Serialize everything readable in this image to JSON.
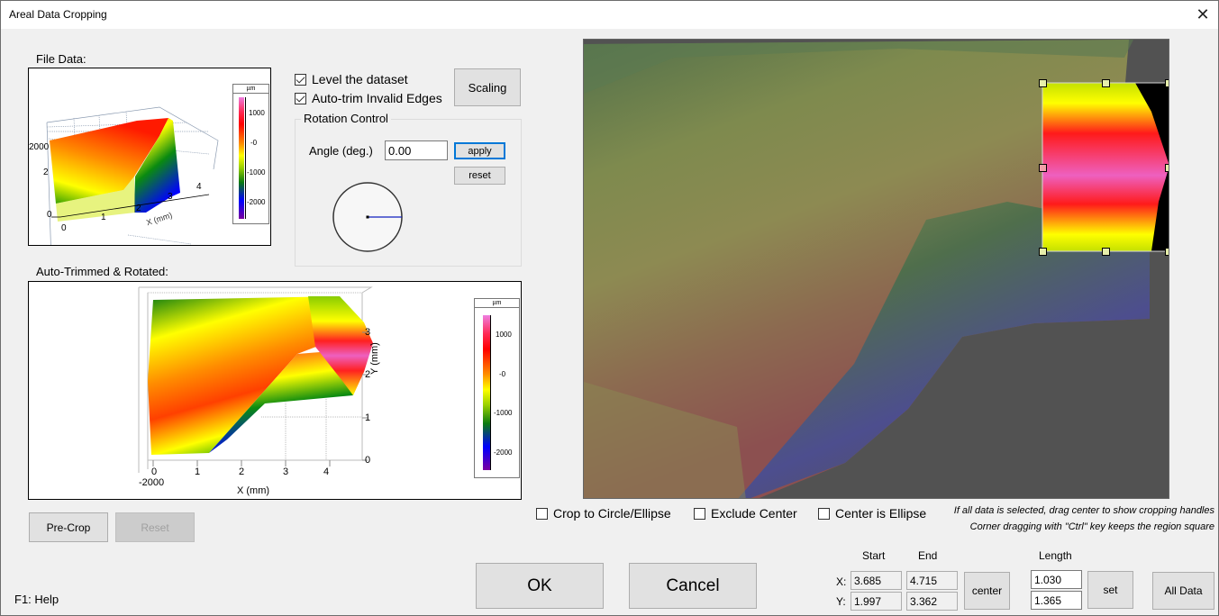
{
  "window": {
    "title": "Areal Data Cropping",
    "close_icon": "close-x"
  },
  "file_data": {
    "label": "File Data:",
    "x_axis_label": "X (mm)",
    "x_ticks": [
      "0",
      "1",
      "2",
      "3",
      "4"
    ],
    "y_ticks": [
      "0",
      "2"
    ],
    "z_tick": "2000",
    "colorbar": {
      "unit": "µm",
      "ticks": [
        "1000",
        "-0",
        "-1000",
        "-2000"
      ]
    }
  },
  "options": {
    "level_dataset": {
      "label": "Level the dataset",
      "checked": true
    },
    "auto_trim": {
      "label": "Auto-trim Invalid Edges",
      "checked": true
    },
    "scaling_button": "Scaling"
  },
  "rotation": {
    "group_label": "Rotation Control",
    "angle_label": "Angle (deg.)",
    "angle_value": "0.00",
    "apply_button": "apply",
    "reset_button": "reset",
    "dial_angle_deg": 0
  },
  "trimmed": {
    "label": "Auto-Trimmed & Rotated:",
    "x_axis_label": "X (mm)",
    "y_axis_label": "Y (mm)",
    "x_ticks": [
      "0",
      "1",
      "2",
      "3",
      "4"
    ],
    "y_ticks": [
      "0",
      "1",
      "2",
      "3"
    ],
    "z_tick": "-2000",
    "colorbar": {
      "unit": "µm",
      "ticks": [
        "1000",
        "-0",
        "-1000",
        "-2000"
      ]
    }
  },
  "precrop": {
    "precrop_button": "Pre-Crop",
    "reset_button": "Reset",
    "reset_disabled": true
  },
  "crop_options": {
    "circle": {
      "label": "Crop to Circle/Ellipse",
      "checked": false
    },
    "exclude_center": {
      "label": "Exclude Center",
      "checked": false
    },
    "center_ellipse": {
      "label": "Center is Ellipse",
      "checked": false
    }
  },
  "hints": {
    "line1": "If all data is selected, drag center to show cropping handles",
    "line2": "Corner dragging with \"Ctrl\" key keeps the region square"
  },
  "coords": {
    "start_header": "Start",
    "end_header": "End",
    "length_header": "Length",
    "x_label": "X:",
    "y_label": "Y:",
    "x_start": "3.685",
    "x_end": "4.715",
    "y_start": "1.997",
    "y_end": "3.362",
    "x_length": "1.030",
    "y_length": "1.365",
    "center_button": "center",
    "set_button": "set",
    "all_data_button": "All Data"
  },
  "footer": {
    "ok_button": "OK",
    "cancel_button": "Cancel",
    "help_text": "F1: Help"
  }
}
